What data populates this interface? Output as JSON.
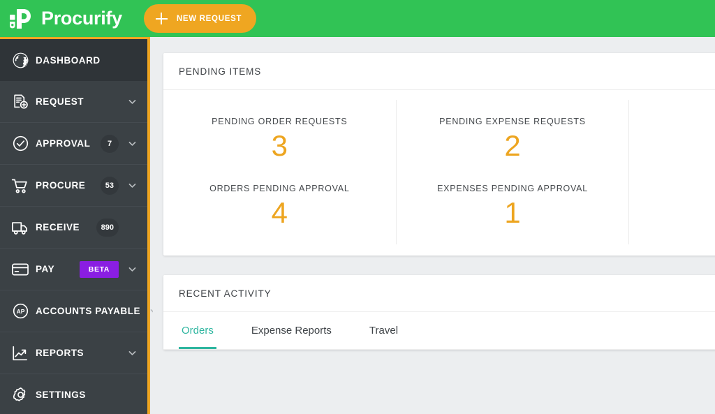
{
  "brand": {
    "name": "Procurify",
    "logo_icon": "procurify-leaf-p-logo",
    "header_color": "#31c355"
  },
  "topbar": {
    "new_request_label": "NEW REQUEST",
    "new_request_icon": "plus-icon",
    "new_request_color": "#efa621"
  },
  "sidebar": {
    "accent_color": "#f0a622",
    "background_color": "#3b4145",
    "items": [
      {
        "label": "DASHBOARD",
        "icon": "globe-icon",
        "badge": null,
        "beta": null,
        "chevron": false,
        "active": true
      },
      {
        "label": "REQUEST",
        "icon": "document-plus-icon",
        "badge": null,
        "beta": null,
        "chevron": true,
        "active": false
      },
      {
        "label": "APPROVAL",
        "icon": "check-circle-icon",
        "badge": "7",
        "beta": null,
        "chevron": true,
        "active": false
      },
      {
        "label": "PROCURE",
        "icon": "shopping-cart-icon",
        "badge": "53",
        "beta": null,
        "chevron": true,
        "active": false
      },
      {
        "label": "RECEIVE",
        "icon": "delivery-truck-icon",
        "badge": "890",
        "beta": null,
        "chevron": false,
        "active": false
      },
      {
        "label": "PAY",
        "icon": "credit-card-icon",
        "badge": null,
        "beta": "BETA",
        "chevron": true,
        "active": false
      },
      {
        "label": "ACCOUNTS PAYABLE",
        "icon": "ap-circle-icon",
        "badge": null,
        "beta": null,
        "chevron": true,
        "active": false
      },
      {
        "label": "REPORTS",
        "icon": "trending-up-chart-icon",
        "badge": null,
        "beta": null,
        "chevron": true,
        "active": false
      },
      {
        "label": "SETTINGS",
        "icon": "gear-icon",
        "badge": null,
        "beta": null,
        "chevron": false,
        "active": false
      }
    ]
  },
  "pending_items": {
    "title": "PENDING ITEMS",
    "accent_color": "#eda520",
    "columns": [
      {
        "stats": [
          {
            "label": "PENDING ORDER REQUESTS",
            "value": "3"
          },
          {
            "label": "ORDERS PENDING APPROVAL",
            "value": "4"
          }
        ]
      },
      {
        "stats": [
          {
            "label": "PENDING EXPENSE REQUESTS",
            "value": "2"
          },
          {
            "label": "EXPENSES PENDING APPROVAL",
            "value": "1"
          }
        ]
      },
      {
        "stats": [
          {
            "label": "",
            "value": ""
          },
          {
            "label": "",
            "value": ""
          }
        ]
      }
    ]
  },
  "recent_activity": {
    "title": "RECENT ACTIVITY",
    "active_tab_color": "#2fb6a0",
    "tabs": [
      {
        "label": "Orders",
        "active": true
      },
      {
        "label": "Expense Reports",
        "active": false
      },
      {
        "label": "Travel",
        "active": false
      }
    ]
  }
}
